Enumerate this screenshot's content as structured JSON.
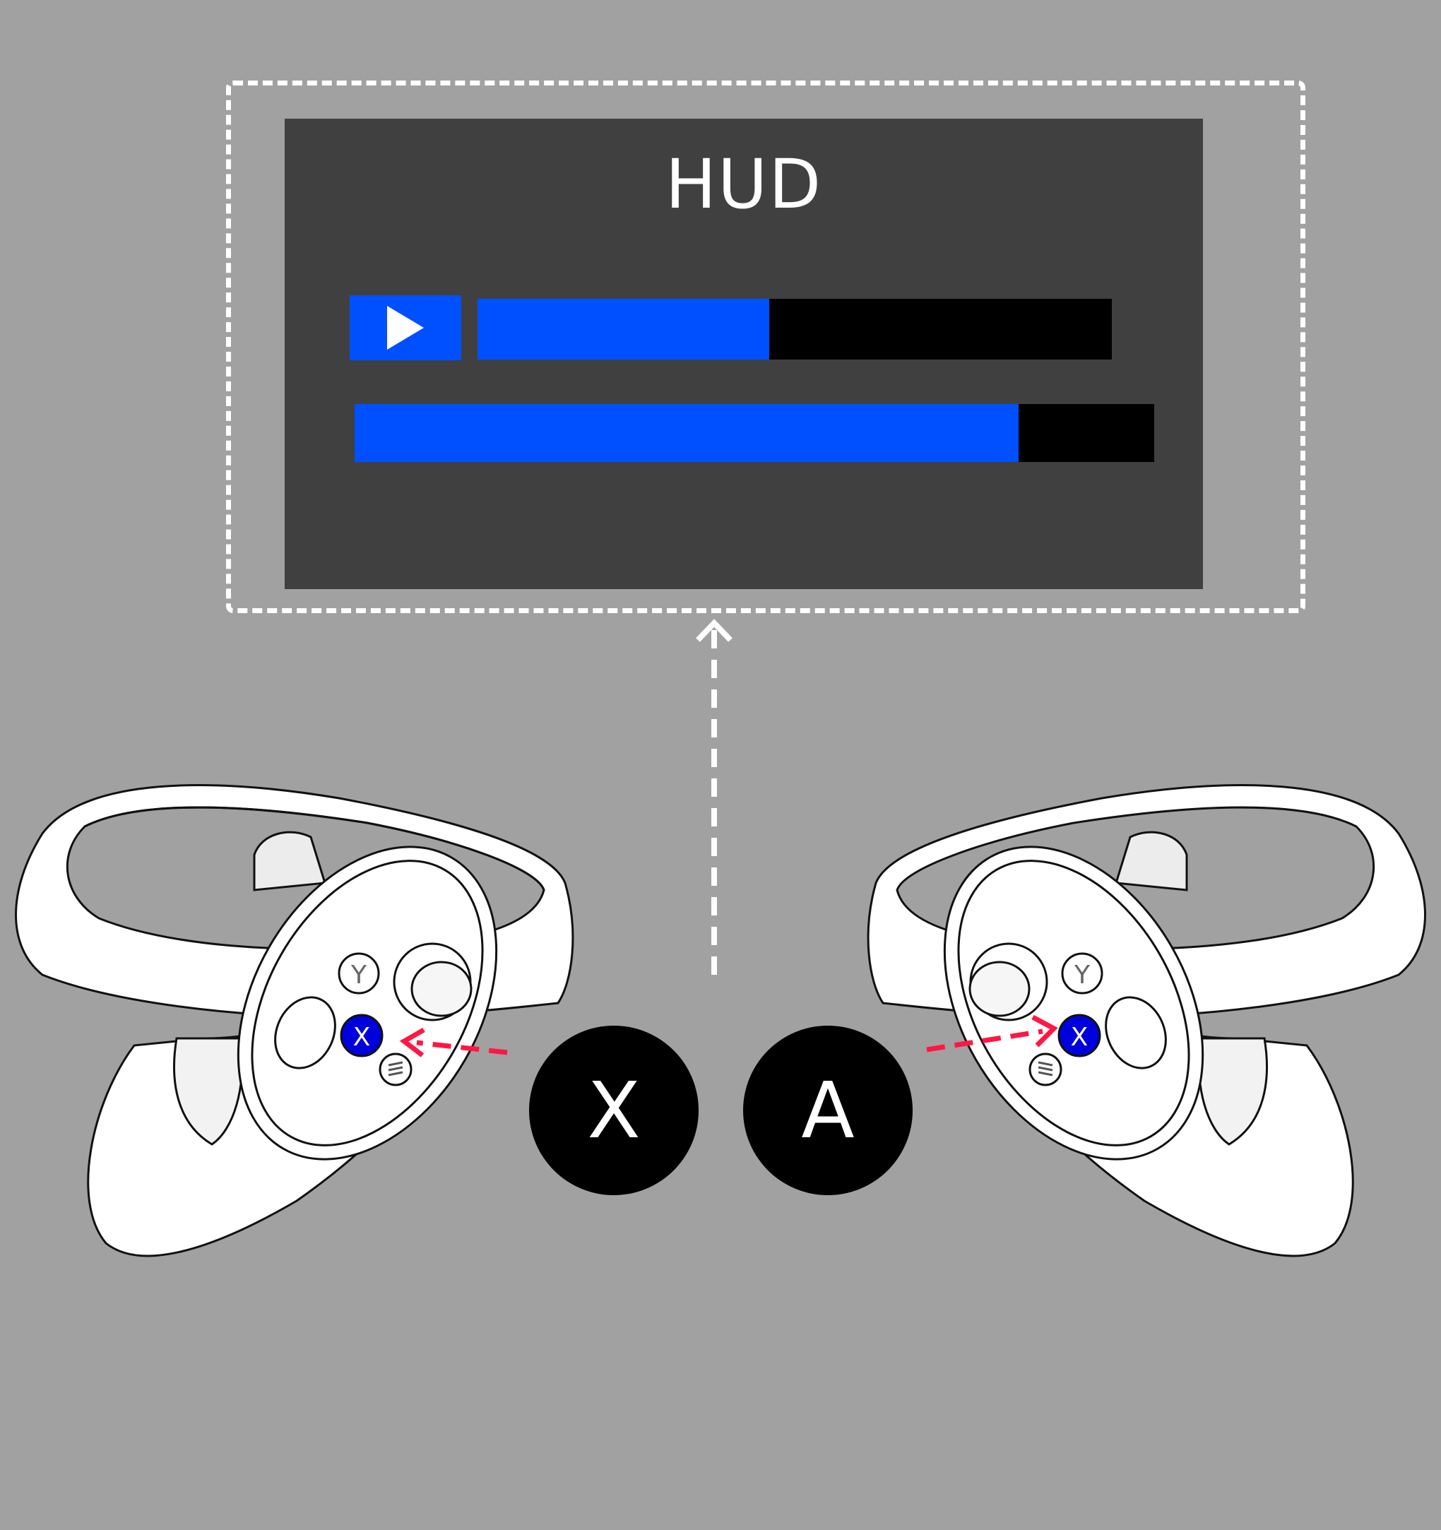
{
  "hud": {
    "title": "HUD",
    "playback_progress": 0.46,
    "secondary_progress": 0.83
  },
  "buttons": {
    "left_badge": "X",
    "right_badge": "A",
    "controller_button_y": "Y",
    "controller_button_x": "X"
  },
  "colors": {
    "background": "#a1a1a1",
    "hud_panel": "#404040",
    "accent_blue": "#0050ff",
    "track_black": "#000000",
    "arrow_red": "#ff1744",
    "button_highlight": "#0000dd"
  },
  "icons": {
    "play": "play-icon",
    "menu": "menu-icon"
  }
}
